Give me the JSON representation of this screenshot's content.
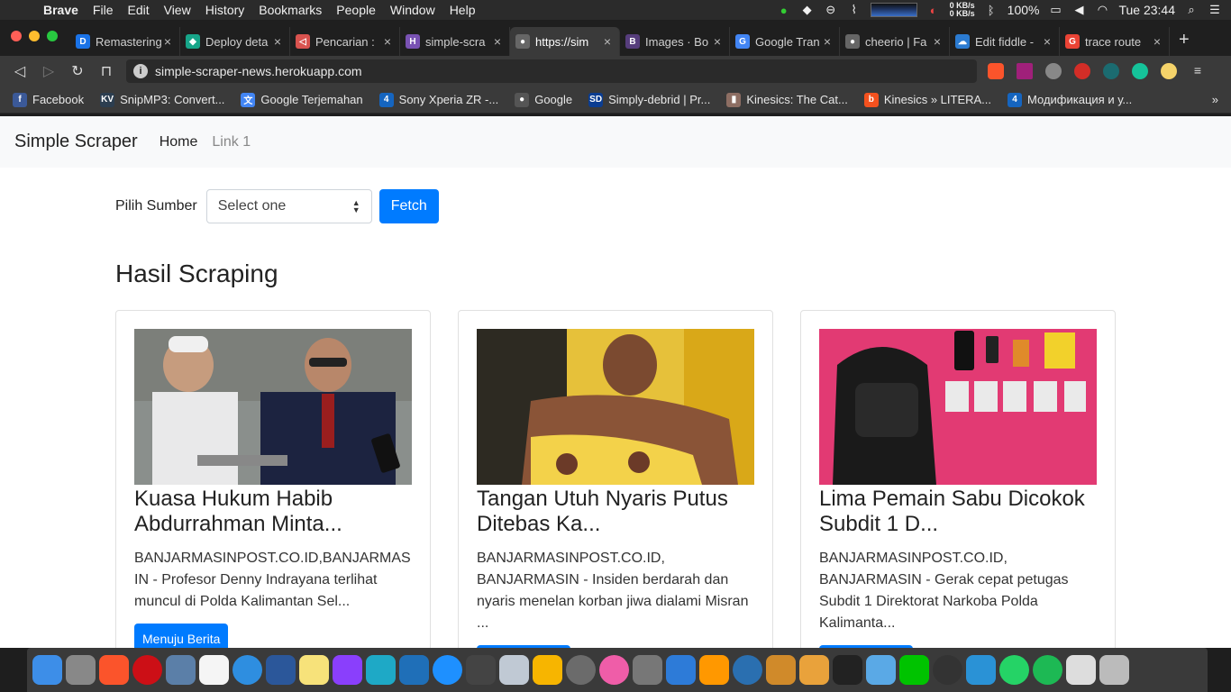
{
  "menubar": {
    "app": "Brave",
    "items": [
      "File",
      "Edit",
      "View",
      "History",
      "Bookmarks",
      "People",
      "Window",
      "Help"
    ],
    "net_up": "0 KB/s",
    "net_down": "0 KB/s",
    "battery": "100%",
    "clock": "Tue 23:44"
  },
  "tabs": [
    {
      "label": "Remastering",
      "fav": "D",
      "color": "#1a73e8"
    },
    {
      "label": "Deploy deta",
      "fav": "◆",
      "color": "#17a589"
    },
    {
      "label": "Pencarian :",
      "fav": "◁",
      "color": "#d9534f"
    },
    {
      "label": "simple-scra",
      "fav": "H",
      "color": "#7952b3"
    },
    {
      "label": "https://sim",
      "fav": "●",
      "color": "#666666"
    },
    {
      "label": "Images · Bo",
      "fav": "B",
      "color": "#563d7c"
    },
    {
      "label": "Google Tran",
      "fav": "G",
      "color": "#4285f4"
    },
    {
      "label": "cheerio | Fa",
      "fav": "●",
      "color": "#666666"
    },
    {
      "label": "Edit fiddle -",
      "fav": "☁",
      "color": "#2b7bd1"
    },
    {
      "label": "trace route",
      "fav": "G",
      "color": "#ea4335"
    }
  ],
  "active_tab": 4,
  "address": "simple-scraper-news.herokuapp.com",
  "bookmarks": [
    {
      "label": "Facebook",
      "fav": "f",
      "color": "#3b5998"
    },
    {
      "label": "SnipMP3: Convert...",
      "fav": "KV",
      "color": "#2c3e50"
    },
    {
      "label": "Google Terjemahan",
      "fav": "文",
      "color": "#4285f4"
    },
    {
      "label": "Sony Xperia ZR -...",
      "fav": "4",
      "color": "#1565c0"
    },
    {
      "label": "Google",
      "fav": "●",
      "color": "#555555"
    },
    {
      "label": "Simply-debrid | Pr...",
      "fav": "SD",
      "color": "#0b3d91"
    },
    {
      "label": "Kinesics: The Cat...",
      "fav": "▮",
      "color": "#8d6e63"
    },
    {
      "label": "Kinesics » LITERA...",
      "fav": "b",
      "color": "#f4511e"
    },
    {
      "label": "Модификация и у...",
      "fav": "4",
      "color": "#1565c0"
    }
  ],
  "bookmarks_more": "»",
  "site": {
    "brand": "Simple Scraper",
    "nav": [
      "Home",
      "Link 1"
    ],
    "form_label": "Pilih Sumber",
    "select_value": "Select one",
    "fetch_label": "Fetch",
    "results_heading": "Hasil Scraping",
    "read_button": "Menuju Berita"
  },
  "cards": [
    {
      "title": "Kuasa Hukum Habib Abdurrahman Minta...",
      "text": "BANJARMASINPOST.CO.ID,BANJARMASIN - Profesor Denny Indrayana terlihat muncul di Polda Kalimantan Sel...",
      "image": "two-men-press-photo"
    },
    {
      "title": "Tangan Utuh Nyaris Putus Ditebas Ka...",
      "text": "BANJARMASINPOST.CO.ID, BANJARMASIN - Insiden berdarah dan nyaris menelan korban jiwa dialami Misran ...",
      "image": "injured-man-photo"
    },
    {
      "title": "Lima Pemain Sabu Dicokok Subdit 1 D...",
      "text": "BANJARMASINPOST.CO.ID, BANJARMASIN - Gerak cepat petugas Subdit 1 Direktorat Narkoba Polda Kalimanta...",
      "image": "evidence-backpack-photo"
    }
  ],
  "colors": {
    "primary": "#007bff",
    "navbar_bg": "#f8f9fa"
  }
}
